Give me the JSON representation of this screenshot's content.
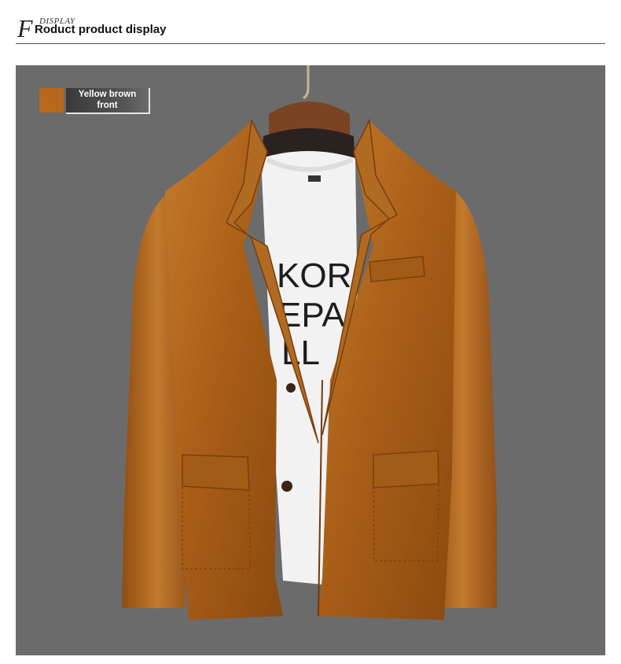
{
  "header": {
    "letter": "F",
    "small_word": "DISPLAY",
    "title": "Roduct product display"
  },
  "product": {
    "color_name": "Yellow brown",
    "view": "front",
    "swatch_color": "#b8681a",
    "background_color": "#6b6b6c",
    "shirt_text": [
      "KOR",
      "EPA",
      "LL"
    ]
  },
  "icons": {
    "hanger": "hanger-icon"
  }
}
